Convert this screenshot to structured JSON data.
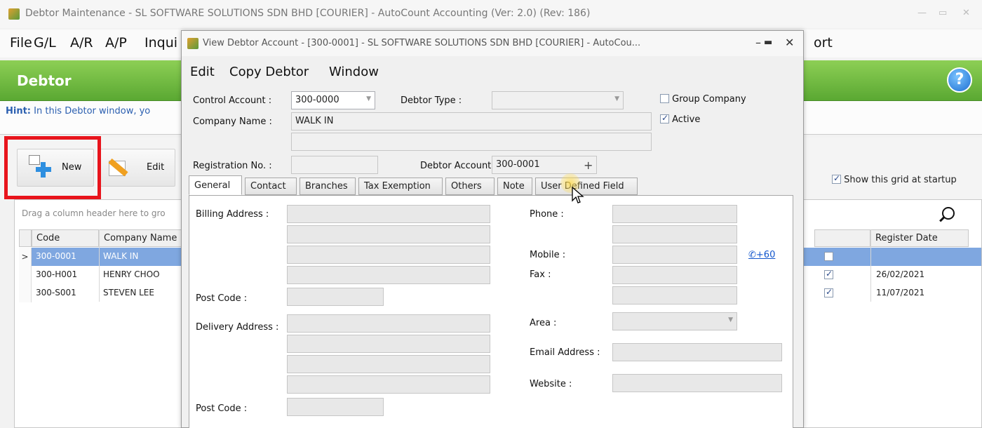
{
  "main_window": {
    "title": "Debtor Maintenance - SL SOFTWARE SOLUTIONS SDN BHD [COURIER] - AutoCount Accounting (Ver: 2.0) (Rev: 186)",
    "menu": {
      "file": "File",
      "gl": "G/L",
      "ar": "A/R",
      "ap": "A/P",
      "inquiry": "Inqui",
      "report_tail": "ort"
    },
    "page_title": "Debtor",
    "hint_label": "Hint:",
    "hint_text": "In this Debtor window, yo",
    "toolbar": {
      "new_label": "New",
      "edit_label": "Edit"
    },
    "show_grid_label": "Show this grid at startup",
    "group_hint": "Drag a column header here to gro",
    "grid": {
      "headers": {
        "code": "Code",
        "company": "Company Name",
        "register_date": "Register Date"
      },
      "rows": [
        {
          "indicator": ">",
          "code": "300-0001",
          "company": "WALK IN",
          "register_date": ""
        },
        {
          "indicator": "",
          "code": "300-H001",
          "company": "HENRY CHOO",
          "register_date": "26/02/2021"
        },
        {
          "indicator": "",
          "code": "300-S001",
          "company": "STEVEN LEE",
          "register_date": "11/07/2021"
        }
      ]
    }
  },
  "dialog": {
    "title": "View Debtor Account - [300-0001] - SL SOFTWARE SOLUTIONS SDN BHD [COURIER] - AutoCou...",
    "menu": {
      "edit": "Edit",
      "copy_debtor": "Copy Debtor",
      "window": "Window"
    },
    "control_account_label": "Control Account :",
    "control_account_value": "300-0000",
    "debtor_type_label": "Debtor Type :",
    "debtor_type_value": "",
    "group_company_label": "Group Company",
    "active_label": "Active",
    "company_name_label": "Company Name :",
    "company_name_value": "WALK IN",
    "company_name2_value": "",
    "registration_label": "Registration No. :",
    "registration_value": "",
    "debtor_account_label": "Debtor Account :",
    "debtor_account_value": "300-0001",
    "tabs": [
      "General",
      "Contact",
      "Branches",
      "Tax Exemption",
      "Others",
      "Note",
      "User Defined Field"
    ],
    "general": {
      "billing_address_label": "Billing Address :",
      "post_code_label": "Post Code :",
      "delivery_address_label": "Delivery Address :",
      "post_code2_label": "Post Code :",
      "phone_label": "Phone :",
      "mobile_label": "Mobile :",
      "fax_label": "Fax :",
      "area_label": "Area :",
      "email_label": "Email  Address :",
      "website_label": "Website :",
      "phone_link": "+60"
    }
  }
}
